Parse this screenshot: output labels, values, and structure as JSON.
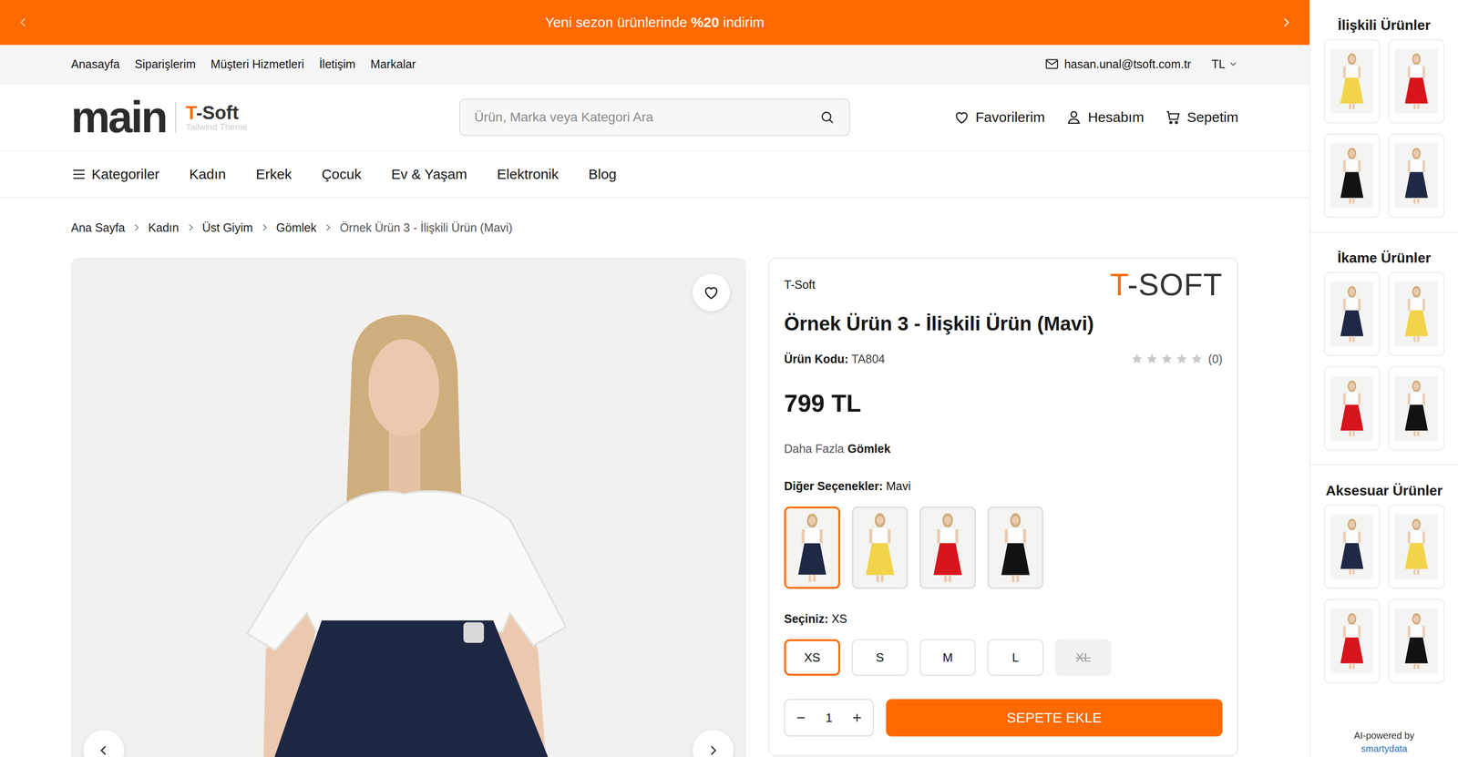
{
  "announcement": {
    "prefix": "Yeni sezon ürünlerinde ",
    "highlight": "%20",
    "suffix": " indirim"
  },
  "topLinks": [
    "Anasayfa",
    "Siparişlerim",
    "Müşteri Hizmetleri",
    "İletişim",
    "Markalar"
  ],
  "account": {
    "email": "hasan.unal@tsoft.com.tr",
    "currency": "TL"
  },
  "logo": {
    "main": "main",
    "brandAccent": "T",
    "brandRest": "-Soft",
    "tagline": "Tailwind Theme"
  },
  "search": {
    "placeholder": "Ürün, Marka veya Kategori Ara"
  },
  "headerActions": [
    {
      "label": "Favorilerim",
      "kind": "heart"
    },
    {
      "label": "Hesabım",
      "kind": "user"
    },
    {
      "label": "Sepetim",
      "kind": "cart"
    }
  ],
  "nav": {
    "categories": "Kategoriler",
    "items": [
      "Kadın",
      "Erkek",
      "Çocuk",
      "Ev & Yaşam",
      "Elektronik",
      "Blog"
    ]
  },
  "breadcrumb": [
    "Ana Sayfa",
    "Kadın",
    "Üst Giyim",
    "Gömlek",
    "Örnek Ürün 3 - İlişkili Ürün (Mavi)"
  ],
  "product": {
    "brand": "T-Soft",
    "brandLogoAccent": "T",
    "brandLogoRest": "-SOFT",
    "title": "Örnek Ürün 3 - İlişkili Ürün (Mavi)",
    "codeLabel": "Ürün Kodu:",
    "code": "TA804",
    "stars": 0,
    "reviewCount": "(0)",
    "price": "799 TL",
    "moreLabel": "Daha Fazla",
    "moreLink": "Gömlek",
    "favorite": false,
    "variantLabel": "Diğer Seçenekler:",
    "variantValue": "Mavi",
    "variants": [
      {
        "color": "#1f2844",
        "selected": true
      },
      {
        "color": "#f2d44a",
        "selected": false
      },
      {
        "color": "#d8141c",
        "selected": false
      },
      {
        "color": "#121212",
        "selected": false
      }
    ],
    "sizeLabel": "Seçiniz:",
    "sizeValue": "XS",
    "sizes": [
      {
        "label": "XS",
        "selected": true,
        "disabled": false
      },
      {
        "label": "S",
        "selected": false,
        "disabled": false
      },
      {
        "label": "M",
        "selected": false,
        "disabled": false
      },
      {
        "label": "L",
        "selected": false,
        "disabled": false
      },
      {
        "label": "XL",
        "selected": false,
        "disabled": true
      }
    ],
    "quantity": "1",
    "addToCart": "SEPETE EKLE"
  },
  "sidebar": {
    "sections": [
      {
        "title": "İlişkili Ürünler",
        "items": [
          {
            "color": "#f2d44a"
          },
          {
            "color": "#d8141c"
          },
          {
            "color": "#121212"
          },
          {
            "color": "#1f2844"
          }
        ]
      },
      {
        "title": "İkame Ürünler",
        "items": [
          {
            "color": "#1f2844"
          },
          {
            "color": "#f2d44a"
          },
          {
            "color": "#d8141c"
          },
          {
            "color": "#121212"
          }
        ]
      },
      {
        "title": "Aksesuar Ürünler",
        "items": [
          {
            "color": "#1f2844"
          },
          {
            "color": "#f2d44a"
          },
          {
            "color": "#d8141c"
          },
          {
            "color": "#121212"
          }
        ]
      }
    ],
    "poweredBy": "AI-powered by",
    "poweredBrand": "smartydata"
  }
}
